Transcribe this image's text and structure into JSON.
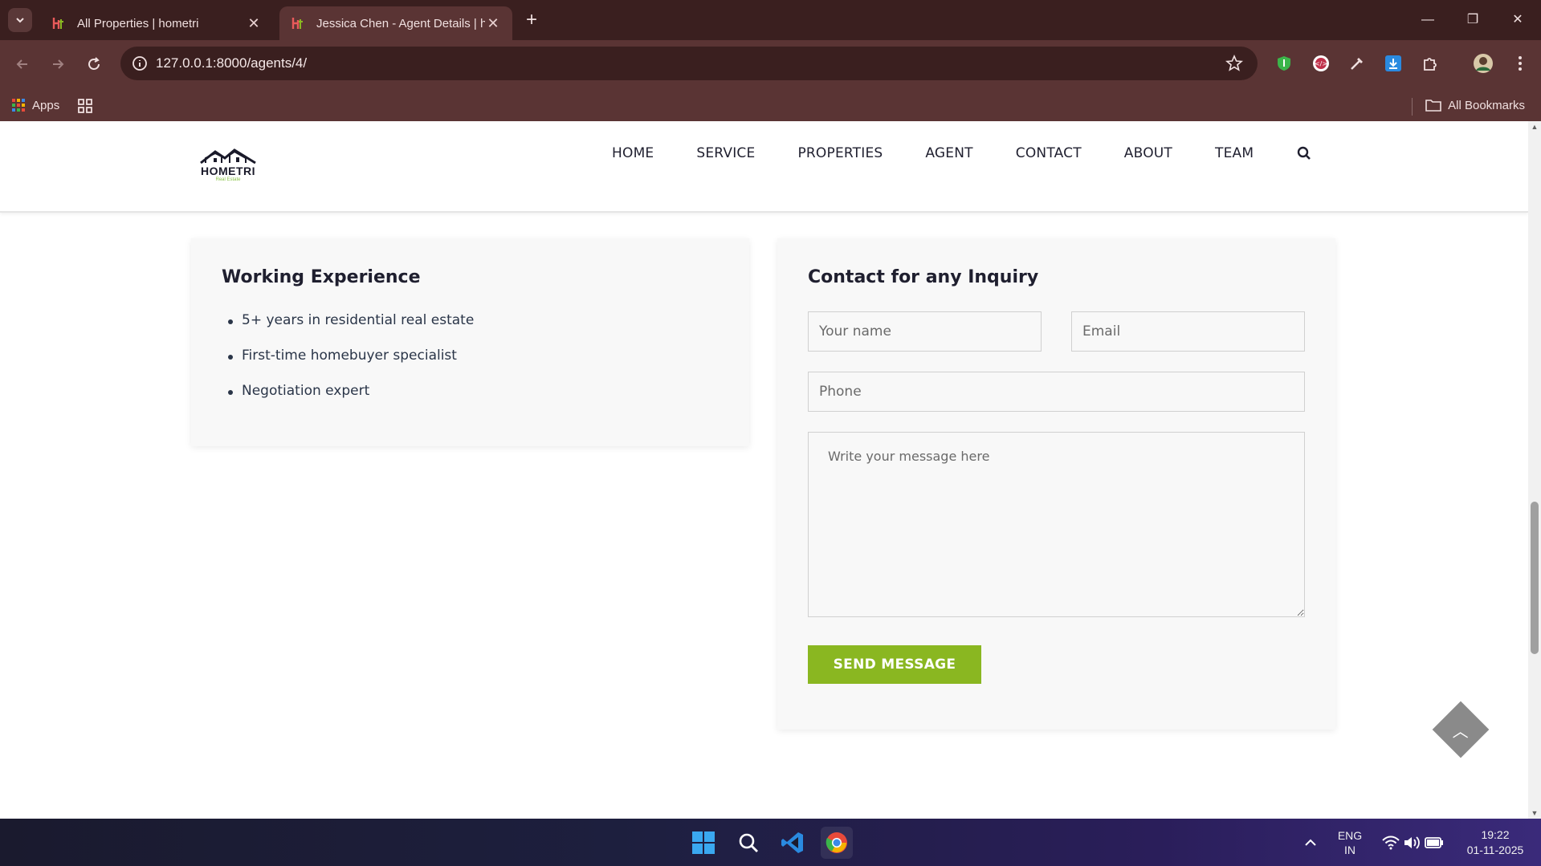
{
  "browser": {
    "tabs": [
      {
        "title": "All Properties | hometri",
        "active": false
      },
      {
        "title": "Jessica Chen - Agent Details | hometri",
        "active": true
      }
    ],
    "url": "127.0.0.1:8000/agents/4/",
    "bookmarks": {
      "apps_label": "Apps",
      "all_bookmarks_label": "All Bookmarks"
    }
  },
  "site": {
    "logo_text": "HOMETRI",
    "logo_sub": "Real Estate",
    "nav": [
      "HOME",
      "SERVICE",
      "PROPERTIES",
      "AGENT",
      "CONTACT",
      "ABOUT",
      "TEAM"
    ]
  },
  "experience": {
    "title": "Working Experience",
    "items": [
      "5+ years in residential real estate",
      "First-time homebuyer specialist",
      "Negotiation expert"
    ]
  },
  "contact_form": {
    "title": "Contact for any Inquiry",
    "name_placeholder": "Your name",
    "email_placeholder": "Email",
    "phone_placeholder": "Phone",
    "message_placeholder": "Write your message here",
    "submit_label": "SEND MESSAGE"
  },
  "taskbar": {
    "lang_line1": "ENG",
    "lang_line2": "IN",
    "time": "19:22",
    "date": "01-11-2025"
  },
  "colors": {
    "accent_green": "#8ab721",
    "chrome_frame": "#3a1f1f",
    "chrome_toolbar": "#5a3434"
  }
}
